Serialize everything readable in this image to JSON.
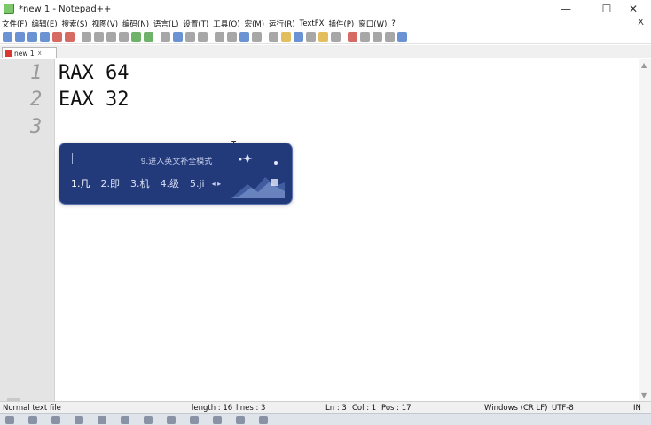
{
  "window": {
    "title": "*new 1 - Notepad++",
    "controls": [
      "—",
      "☐",
      "✕"
    ]
  },
  "menu": {
    "items": [
      "文件(F)",
      "编辑(E)",
      "搜索(S)",
      "视图(V)",
      "编码(N)",
      "语言(L)",
      "设置(T)",
      "工具(O)",
      "宏(M)",
      "运行(R)",
      "TextFX",
      "插件(P)",
      "窗口(W)",
      "?"
    ],
    "close": "X"
  },
  "toolbar": {
    "icons": [
      "new-file-icon",
      "open-file-icon",
      "save-icon",
      "save-all-icon",
      "close-icon",
      "close-all-icon",
      "print-icon",
      "cut-icon",
      "copy-icon",
      "paste-icon",
      "undo-icon",
      "redo-icon",
      "find-icon",
      "replace-icon",
      "zoom-in-icon",
      "zoom-out-icon",
      "sync-v-icon",
      "sync-h-icon",
      "wrap-icon",
      "all-chars-icon",
      "indent-guide-icon",
      "udl-icon",
      "doc-map-icon",
      "function-list-icon",
      "folder-workspace-icon",
      "monitor-icon",
      "record-icon",
      "stop-icon",
      "play-icon",
      "play-multi-icon",
      "save-macro-icon"
    ],
    "colors": {
      "blue": "#3a6fc4",
      "green": "#3f9a3a",
      "red": "#c83a30",
      "gray": "#8a8a8a",
      "yellow": "#d9a82a"
    }
  },
  "tab": {
    "label": "new 1",
    "close": "x"
  },
  "editor": {
    "line_numbers": [
      "1",
      "2",
      "3"
    ],
    "lines": [
      "RAX 64",
      "EAX 32",
      ""
    ]
  },
  "ime": {
    "mode_text": "9.进入英文补全模式",
    "candidates": [
      "1.几",
      "2.即",
      "3.机",
      "4.级",
      "5.ji"
    ],
    "arrows": "◂ ▸",
    "bg_color": "#22397a"
  },
  "status": {
    "type": "Normal text file",
    "length": "length : 16",
    "lines": "lines : 3",
    "ln": "Ln : 3",
    "col": "Col : 1",
    "pos": "Pos : 17",
    "eol": "Windows (CR LF)",
    "encoding": "UTF-8",
    "mode": "IN"
  }
}
